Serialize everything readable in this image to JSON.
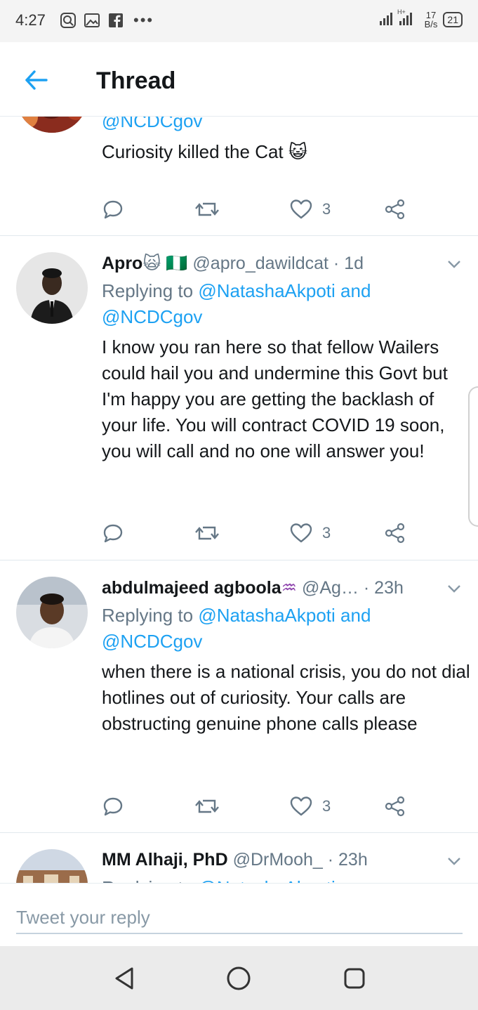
{
  "status_bar": {
    "time": "4:27",
    "net_speed_value": "17",
    "net_speed_unit": "B/s",
    "battery": "21",
    "dots": "•••"
  },
  "header": {
    "title": "Thread"
  },
  "tweets": [
    {
      "mention": "@NCDCgov",
      "text": "Curiosity killed the Cat 😺",
      "likes": "3"
    },
    {
      "name": "Apro",
      "name_emoji": "🙀 🇳🇬",
      "handle": "@apro_dawildcat",
      "time": "· 1d",
      "replying_prefix": "Replying to",
      "replying_link": "@NatashaAkpoti and",
      "replying_link2": "@NCDCgov",
      "text": "I know you  ran here so that fellow Wailers could hail you  and undermine this Govt but I'm happy you are  getting the backlash of your  life. You will contract COVID 19 soon, you will call and no one will answer you!",
      "likes": "3"
    },
    {
      "name": "abdulmajeed agboola",
      "name_emoji": "♒",
      "handle": "@Ag…",
      "time": "· 23h",
      "replying_prefix": "Replying to",
      "replying_link": "@NatashaAkpoti and",
      "replying_link2": "@NCDCgov",
      "text": "when there is a national crisis, you do not dial hotlines out of curiosity. Your calls are obstructing genuine phone calls please",
      "likes": "3"
    },
    {
      "name": "MM Alhaji, PhD",
      "handle": "@DrMooh_",
      "time": "· 23h",
      "replying_prefix": "Replying to",
      "replying_link": "@NatashaAkpoti"
    }
  ],
  "reply_bar": {
    "placeholder": "Tweet your reply"
  },
  "colors": {
    "accent": "#1da1f2",
    "muted": "#657786",
    "text": "#14171a"
  }
}
